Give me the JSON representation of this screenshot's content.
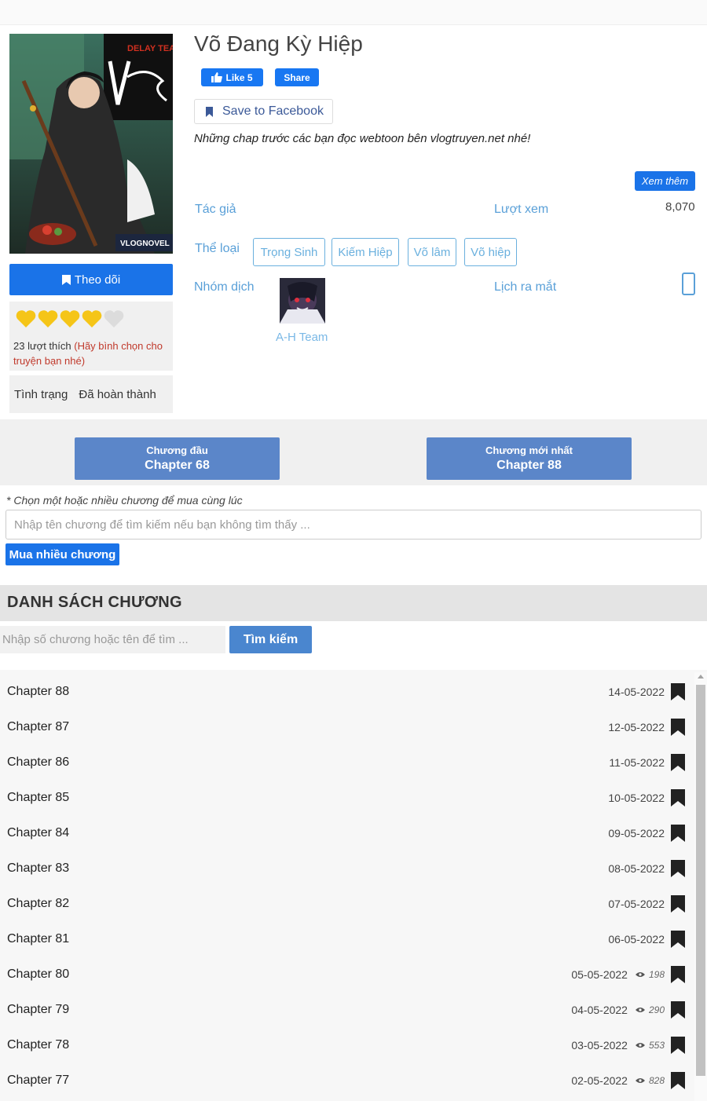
{
  "manga": {
    "title": "Võ Đang Kỳ Hiệp",
    "description": "Những chap trước các bạn đọc webtoon bên vlogtruyen.net nhé!",
    "cover_text": {
      "team": "DELAY TEAM",
      "logo": "VLOGNOVEL"
    }
  },
  "social": {
    "like_label": "Like 5",
    "share_label": "Share",
    "save_label": "Save to Facebook"
  },
  "sidebar": {
    "follow_label": "Theo dõi",
    "rating": {
      "filled": 4,
      "total": 5
    },
    "likes_text": "23 lượt thích",
    "rate_hint": "(Hãy bình chọn cho truyện bạn nhé)",
    "status_label": "Tình trạng",
    "status_value": "Đã hoàn thành"
  },
  "info": {
    "more_label": "Xem thêm",
    "author_label": "Tác giả",
    "views_label": "Lượt xem",
    "views_value": "8,070",
    "genre_label": "Thể loại",
    "genres": [
      "Trọng Sinh",
      "Kiếm Hiệp",
      "Võ lâm",
      "Võ hiệp"
    ],
    "team_label": "Nhóm dịch",
    "team_name": "A-H Team",
    "release_label": "Lịch ra mắt"
  },
  "jump": {
    "first": {
      "small": "Chương đầu",
      "big": "Chapter 68"
    },
    "latest": {
      "small": "Chương mới nhất",
      "big": "Chapter 88"
    }
  },
  "buy": {
    "note": "* Chọn một hoặc nhiều chương để mua cùng lúc",
    "placeholder": "Nhập tên chương để tìm kiếm nếu bạn không tìm thấy ...",
    "button": "Mua nhiều chương"
  },
  "chapter_list": {
    "heading": "DANH SÁCH CHƯƠNG",
    "search_placeholder": "Nhập số chương hoặc tên để tìm ...",
    "search_button": "Tìm kiếm",
    "chapters": [
      {
        "name": "Chapter 88",
        "date": "14-05-2022",
        "views": ""
      },
      {
        "name": "Chapter 87",
        "date": "12-05-2022",
        "views": ""
      },
      {
        "name": "Chapter 86",
        "date": "11-05-2022",
        "views": ""
      },
      {
        "name": "Chapter 85",
        "date": "10-05-2022",
        "views": ""
      },
      {
        "name": "Chapter 84",
        "date": "09-05-2022",
        "views": ""
      },
      {
        "name": "Chapter 83",
        "date": "08-05-2022",
        "views": ""
      },
      {
        "name": "Chapter 82",
        "date": "07-05-2022",
        "views": ""
      },
      {
        "name": "Chapter 81",
        "date": "06-05-2022",
        "views": ""
      },
      {
        "name": "Chapter 80",
        "date": "05-05-2022",
        "views": "198"
      },
      {
        "name": "Chapter 79",
        "date": "04-05-2022",
        "views": "290"
      },
      {
        "name": "Chapter 78",
        "date": "03-05-2022",
        "views": "553"
      },
      {
        "name": "Chapter 77",
        "date": "02-05-2022",
        "views": "828"
      }
    ]
  },
  "colors": {
    "primary": "#1a73e8",
    "jump_button": "#5b86c9",
    "label": "#5aa0d8",
    "heart": "#f5c518"
  }
}
